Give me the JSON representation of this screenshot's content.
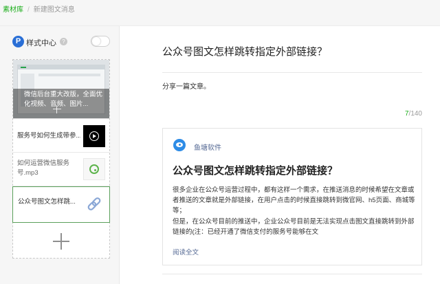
{
  "breadcrumb": {
    "parent": "素材库",
    "separator": "/",
    "current": "新建图文消息"
  },
  "style_center": {
    "badge": "P",
    "label": "样式中心",
    "help": "?",
    "toggle_on": false
  },
  "articles": [
    {
      "type": "cover",
      "title": "微信后台重大改版，全面优化视频、音频、图片..."
    },
    {
      "type": "video",
      "title": "服务号如何生成带参..."
    },
    {
      "type": "audio",
      "title": "如何运营微信服务号.mp3"
    },
    {
      "type": "link",
      "title": "公众号图文怎样跳...",
      "selected": true
    }
  ],
  "editor": {
    "title": "公众号图文怎样跳转指定外部链接？",
    "digest": "分享一篇文章。",
    "count_current": "7",
    "count_sep": "/",
    "count_max": "140"
  },
  "preview": {
    "account_name": "鱼塘软件",
    "title": "公众号图文怎样跳转指定外部链接？",
    "body": "很多企业在公众号运营过程中，都有这样一个需求，在推送消息的时候希望在文章或者推送的文章就是外部链接，在用户点击的时候直接跳转到微官网、h5页面、商城等等；",
    "body2": "但是，在公众号目前的推送中，企业公众号目前是无法实现点击图文直接跳转到外部链接的(注：已经开通了微信支付的服务号能够在文",
    "read_more": "阅读全文"
  },
  "colors": {
    "accent_green": "#1aad19",
    "link_blue": "#576b95",
    "badge_blue": "#2a6fd6"
  }
}
